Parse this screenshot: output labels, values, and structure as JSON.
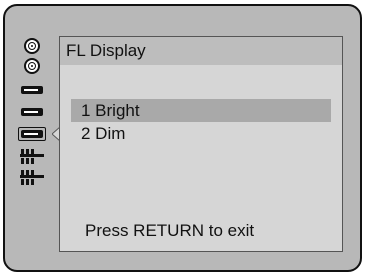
{
  "panel": {
    "title": "FL Display",
    "footer_hint": "Press RETURN to exit"
  },
  "menu": {
    "items": [
      {
        "label": "1 Bright",
        "selected": true
      },
      {
        "label": "2 Dim",
        "selected": false
      }
    ]
  },
  "sidebar": {
    "icons": [
      "disc-icon",
      "disc-icon",
      "deck-icon",
      "deck-icon",
      "deck-icon-selected",
      "av-jacks-icon",
      "av-jacks-icon"
    ]
  },
  "colors": {
    "frame": "#b8b8b8",
    "panel": "#d6d6d6",
    "title_bar": "#bdbdbd",
    "selection": "#a9a9a9",
    "text": "#111111"
  }
}
